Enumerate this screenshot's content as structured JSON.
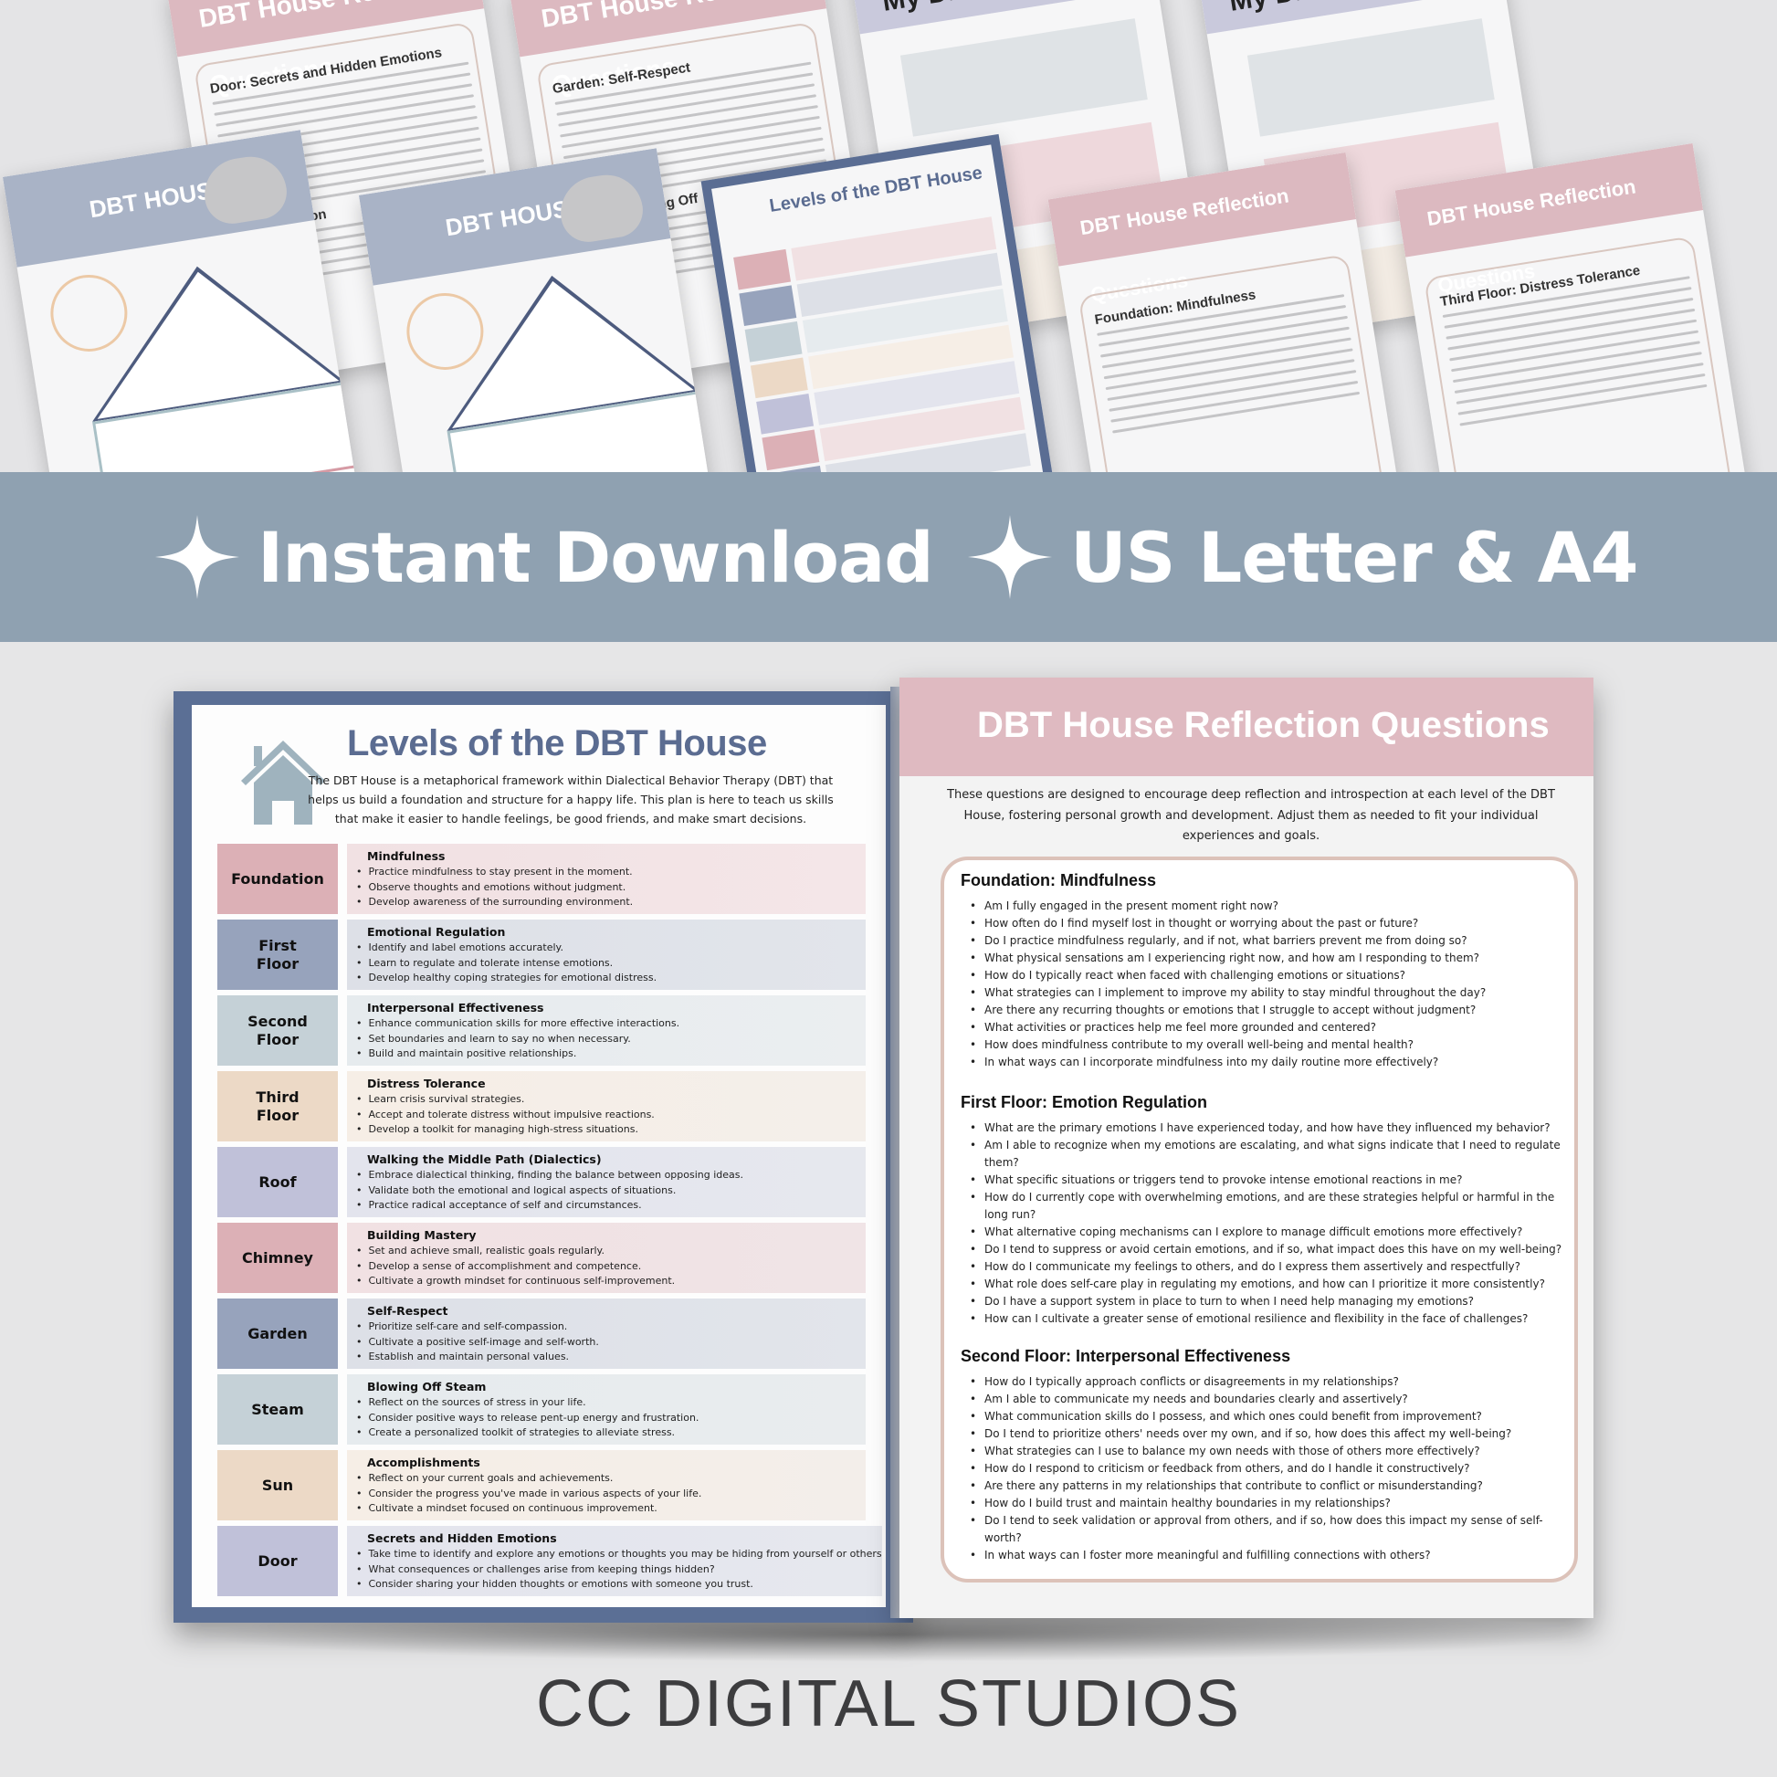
{
  "banner": {
    "items": [
      {
        "icon": "sparkle-icon",
        "label": "Instant Download"
      },
      {
        "icon": "sparkle-icon",
        "label": "US Letter & A4"
      }
    ]
  },
  "collage": {
    "thumbnails": [
      {
        "type": "reflection",
        "title": "DBT House Reflection Questions",
        "section": "Door:  Secrets and Hidden Emotions",
        "section2": "Self Reflection"
      },
      {
        "type": "reflection",
        "title": "DBT House Reflection Questions",
        "section": "Garden:  Self-Respect",
        "section2": "Steam:  Blowing Off"
      },
      {
        "type": "my-house",
        "title": "My DBT House"
      },
      {
        "type": "my-house",
        "title": "My DBT House"
      },
      {
        "type": "house-worksheet",
        "title": "DBT HOUSE"
      },
      {
        "type": "house-worksheet",
        "title": "DBT HOUSE"
      },
      {
        "type": "levels",
        "title": "Levels of the DBT House"
      },
      {
        "type": "reflection",
        "title": "DBT House Reflection Questions",
        "section": "Foundation:  Mindfulness"
      },
      {
        "type": "reflection",
        "title": "DBT House Reflection Questions",
        "section": "Third Floor:  Distress Tolerance"
      }
    ]
  },
  "left_page": {
    "title": "Levels of the DBT House",
    "intro": "The DBT House is a metaphorical framework within Dialectical Behavior Therapy (DBT) that helps us build a foundation and structure for a happy life. This plan is here to teach us skills that make it easier to handle feelings, be good friends, and make smart decisions.",
    "levels": [
      {
        "label": "Foundation",
        "color": "#dcb0b6",
        "bg": "#f1e1e3",
        "heading": "Mindfulness",
        "bullets": [
          "Practice mindfulness to stay present in the moment.",
          "Observe thoughts and emotions without judgment.",
          "Develop awareness of the surrounding environment."
        ]
      },
      {
        "label": "First Floor",
        "color": "#97a3bc",
        "bg": "#dde0e7",
        "heading": "Emotional Regulation",
        "bullets": [
          "Identify and label emotions accurately.",
          "Learn to regulate and tolerate intense emotions.",
          "Develop healthy coping strategies for emotional distress."
        ]
      },
      {
        "label": "Second Floor",
        "color": "#c5d1d7",
        "bg": "#e6ebee",
        "heading": "Interpersonal Effectiveness",
        "bullets": [
          "Enhance communication skills for more effective interactions.",
          "Set boundaries and learn to say no when necessary.",
          "Build and maintain positive relationships."
        ]
      },
      {
        "label": "Third Floor",
        "color": "#ecd9c6",
        "bg": "#f6eee6",
        "heading": "Distress Tolerance",
        "bullets": [
          "Learn crisis survival strategies.",
          "Accept and tolerate distress without impulsive reactions.",
          "Develop a toolkit for managing high-stress situations."
        ]
      },
      {
        "label": "Roof",
        "color": "#c0c1d9",
        "bg": "#e3e4ed",
        "heading": "Walking the Middle Path (Dialectics)",
        "bullets": [
          "Embrace dialectical thinking, finding the balance between opposing ideas.",
          "Validate both the emotional and logical aspects of situations.",
          "Practice radical acceptance of self and circumstances."
        ]
      },
      {
        "label": "Chimney",
        "color": "#dcb0b6",
        "bg": "#f1e1e3",
        "heading": "Building Mastery",
        "bullets": [
          "Set and achieve small, realistic goals regularly.",
          "Develop a sense of accomplishment and competence.",
          "Cultivate a growth mindset for continuous self-improvement."
        ]
      },
      {
        "label": "Garden",
        "color": "#97a3bc",
        "bg": "#dde0e7",
        "heading": "Self-Respect",
        "bullets": [
          "Prioritize self-care and self-compassion.",
          "Cultivate a positive self-image and self-worth.",
          "Establish and maintain personal values."
        ]
      },
      {
        "label": "Steam",
        "color": "#c5d1d7",
        "bg": "#e6ebee",
        "heading": "Blowing Off Steam",
        "bullets": [
          "Reflect on the sources of stress in your life.",
          "Consider positive ways to release pent-up energy and frustration.",
          "Create a personalized toolkit of strategies to alleviate stress."
        ]
      },
      {
        "label": "Sun",
        "color": "#ecd9c6",
        "bg": "#f6eee6",
        "heading": "Accomplishments",
        "bullets": [
          "Reflect on your current goals and achievements.",
          "Consider the progress you've made in various aspects of your life.",
          "Cultivate a mindset focused on continuous improvement."
        ]
      },
      {
        "label": "Door",
        "color": "#c0c1d9",
        "bg": "#e3e4ed",
        "heading": "Secrets and Hidden Emotions",
        "bullets": [
          "Take time to identify and explore any emotions or thoughts you may be hiding from yourself or others",
          "What consequences or challenges arise from keeping things hidden?",
          "Consider sharing your hidden thoughts or emotions with someone you trust."
        ]
      }
    ]
  },
  "right_page": {
    "title": "DBT House Reflection Questions",
    "intro": "These questions are designed to encourage deep reflection and introspection at each level of the DBT House, fostering personal growth and development. Adjust them as needed to fit your individual experiences and goals.",
    "sections": [
      {
        "heading": "Foundation:  Mindfulness",
        "questions": [
          "Am I fully engaged in the present moment right now?",
          "How often do I find myself lost in thought or worrying about the past or future?",
          "Do I practice mindfulness regularly, and if not, what barriers prevent me from doing so?",
          "What physical sensations am I experiencing right now, and how am I responding to them?",
          "How do I typically react when faced with challenging emotions or situations?",
          "What strategies can I implement to improve my ability to stay mindful throughout the day?",
          "Are there any recurring thoughts or emotions that I struggle to accept without judgment?",
          "What activities or practices help me feel more grounded and centered?",
          "How does mindfulness contribute to my overall well-being and mental health?",
          "In what ways can I incorporate mindfulness into my daily routine more effectively?"
        ]
      },
      {
        "heading": "First Floor:  Emotion Regulation",
        "questions": [
          "What are the primary emotions I have experienced today, and how have they influenced my behavior?",
          "Am I able to recognize when my emotions are escalating, and what signs indicate that I need to regulate them?",
          "What specific situations or triggers tend to provoke intense emotional reactions in me?",
          "How do I currently cope with overwhelming emotions, and are these strategies helpful or harmful in the long run?",
          "What alternative coping mechanisms can I explore to manage difficult emotions more effectively?",
          "Do I tend to suppress or avoid certain emotions, and if so, what impact does this have on my well-being?",
          "How do I communicate my feelings to others, and do I express them assertively and respectfully?",
          "What role does self-care play in regulating my emotions, and how can I prioritize it more consistently?",
          "Do I have a support system in place to turn to when I need help managing my emotions?",
          "How can I cultivate a greater sense of emotional resilience and flexibility in the face of challenges?"
        ]
      },
      {
        "heading": "Second Floor:  Interpersonal Effectiveness",
        "questions": [
          "How do I typically approach conflicts or disagreements in my relationships?",
          "Am I able to communicate my needs and boundaries clearly and assertively?",
          "What communication skills do I possess, and which ones could benefit from improvement?",
          "Do I tend to prioritize others' needs over my own, and if so, how does this affect my well-being?",
          "What strategies can I use to balance my own needs with those of others more effectively?",
          "How do I respond to criticism or feedback from others, and do I handle it constructively?",
          "Are there any patterns in my relationships that contribute to conflict or misunderstanding?",
          "How do I build trust and maintain healthy boundaries in my relationships?",
          "Do I tend to seek validation or approval from others, and if so, how does this impact my sense of self-worth?",
          "In what ways can I foster more meaningful and fulfilling connections with others?"
        ]
      }
    ]
  },
  "brand": "CC DIGITAL STUDIOS",
  "colors": {
    "banner": "#8fa1b1",
    "cover_blue": "#5b6f95",
    "title_blue": "#5b6c91",
    "header_pink": "#dfbac1",
    "box_border": "#dcc2b9"
  }
}
